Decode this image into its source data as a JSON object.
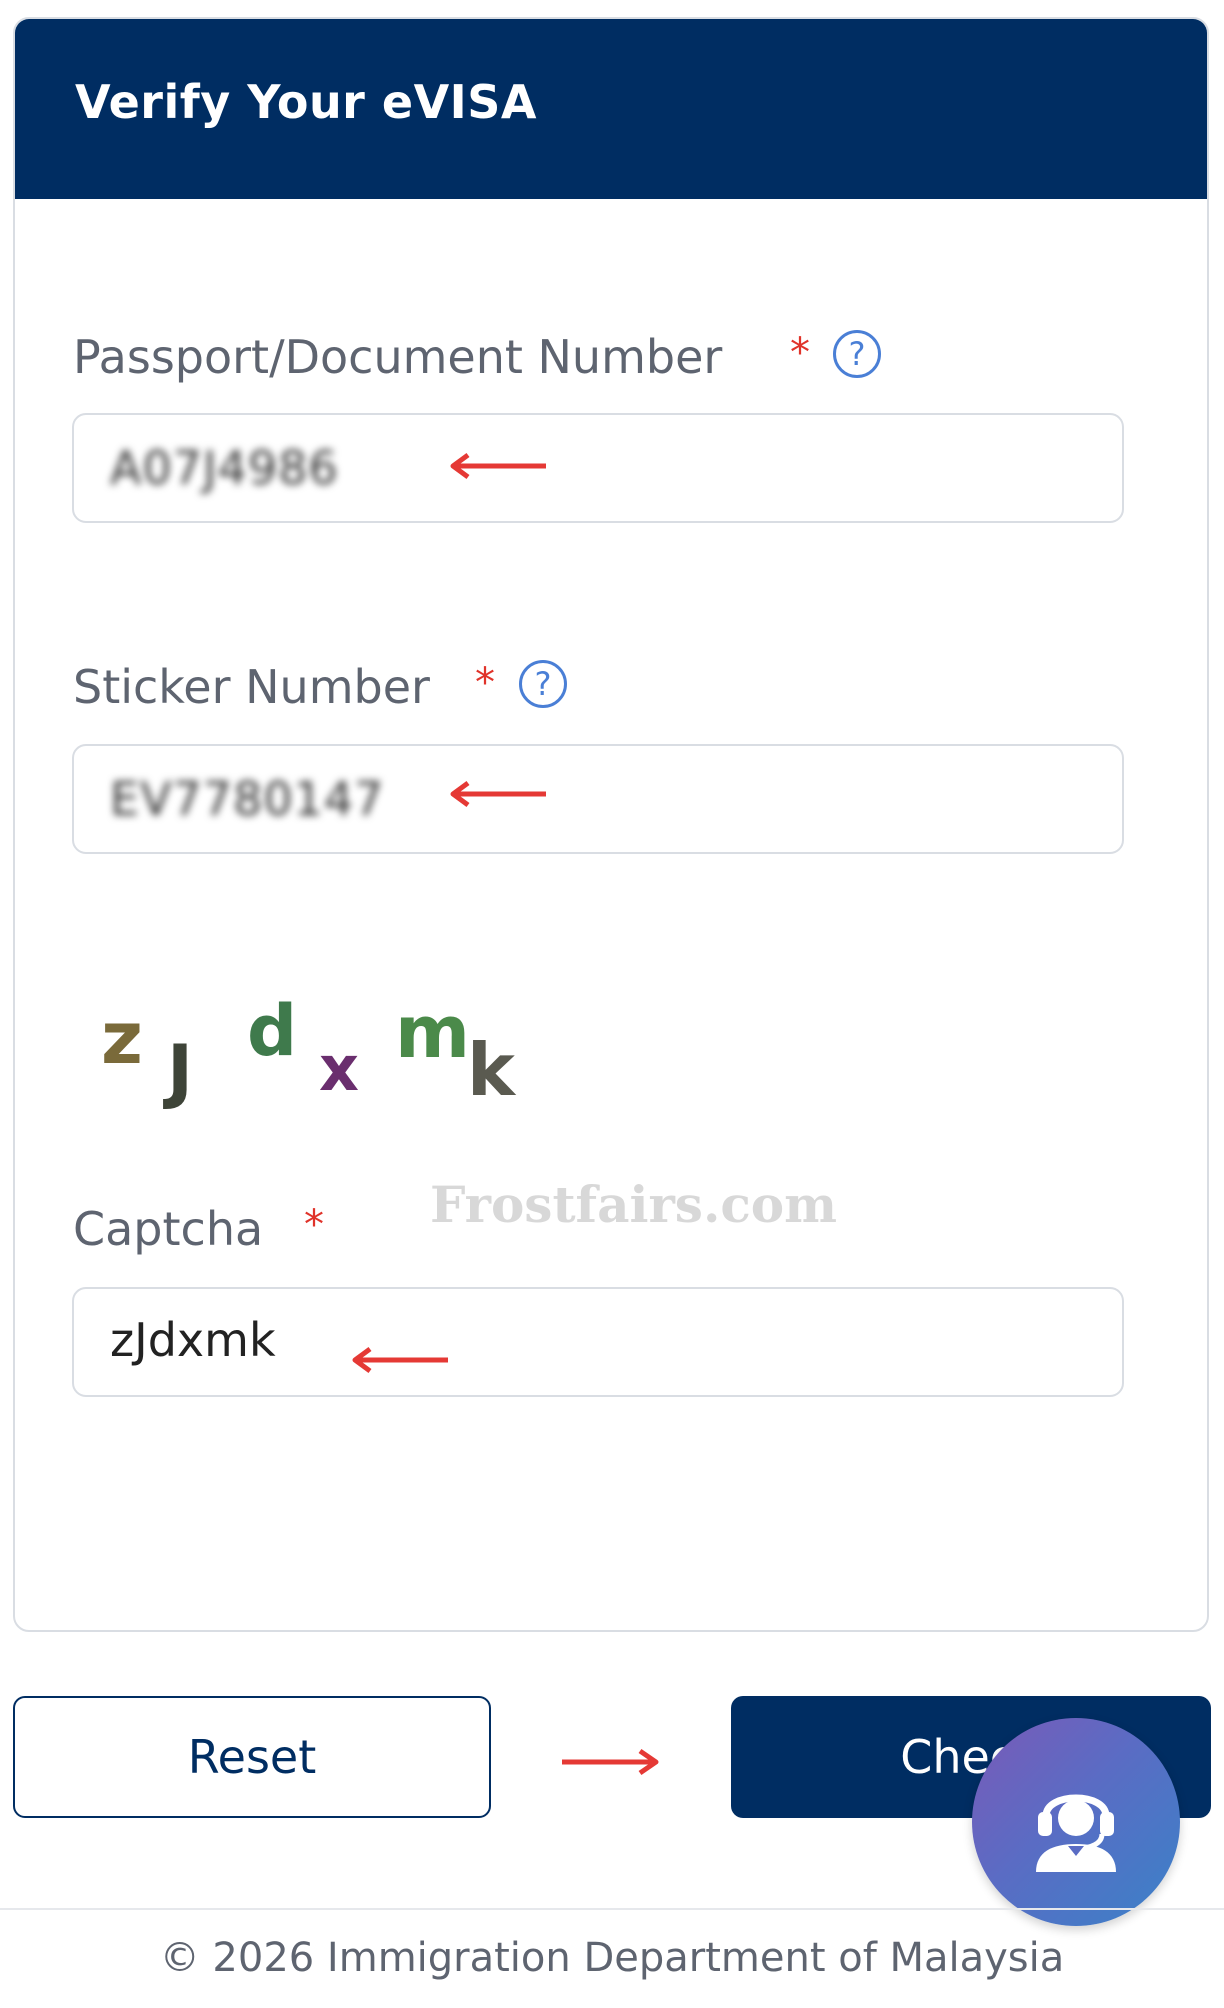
{
  "header": {
    "title": "Verify Your eVISA"
  },
  "form": {
    "passport": {
      "label": "Passport/Document Number",
      "required_mark": "*",
      "help_glyph": "?",
      "value": "A07J4986"
    },
    "sticker": {
      "label": "Sticker Number",
      "required_mark": "*",
      "help_glyph": "?",
      "value": "EV7780147"
    },
    "captcha": {
      "image_text": [
        "z",
        "J",
        "d",
        "x",
        "m",
        "k"
      ],
      "label": "Captcha",
      "required_mark": "*",
      "value": "zJdxmk"
    }
  },
  "watermark": "Frostfairs.com",
  "buttons": {
    "reset_label": "Reset",
    "check_label": "Check"
  },
  "footer": {
    "copyright": "© 2026 Immigration Department of Malaysia"
  },
  "colors": {
    "brand_navy": "#002d62",
    "required_red": "#e0332a",
    "help_blue": "#4a7fd6",
    "annotation_arrow": "#e53935"
  },
  "icons": {
    "help": "question-circle-icon",
    "support": "headset-agent-icon",
    "annotation": "red-arrow-icon"
  }
}
